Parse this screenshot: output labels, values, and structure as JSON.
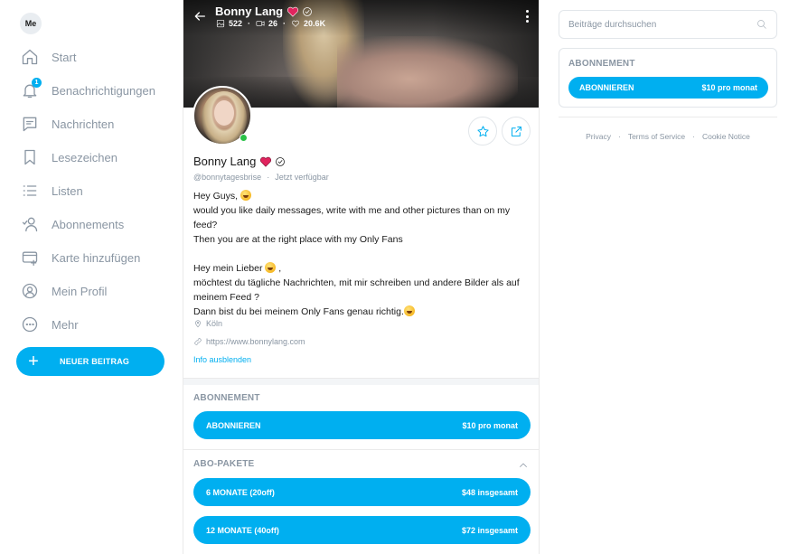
{
  "sidebar": {
    "avatar_initials": "Me",
    "notification_count": "1",
    "items": [
      {
        "label": "Start",
        "icon": "home-icon"
      },
      {
        "label": "Benachrichtigungen",
        "icon": "bell-icon"
      },
      {
        "label": "Nachrichten",
        "icon": "message-icon"
      },
      {
        "label": "Lesezeichen",
        "icon": "bookmark-icon"
      },
      {
        "label": "Listen",
        "icon": "list-icon"
      },
      {
        "label": "Abonnements",
        "icon": "subscriptions-icon"
      },
      {
        "label": "Karte hinzufügen",
        "icon": "card-icon"
      },
      {
        "label": "Mein Profil",
        "icon": "profile-icon"
      },
      {
        "label": "Mehr",
        "icon": "more-icon"
      }
    ],
    "new_post_label": "NEUER BEITRAG"
  },
  "cover": {
    "name": "Bonny Lang",
    "photos": "522",
    "videos": "26",
    "likes": "20.6K"
  },
  "profile": {
    "name": "Bonny Lang",
    "handle": "@bonnytagesbrise",
    "status": "Jetzt verfügbar",
    "bio_en_1": "Hey Guys, ",
    "bio_en_2": "would you like daily messages, write with me and other pictures than on my feed?",
    "bio_en_3": "Then you are at the right place with my Only Fans",
    "bio_de_1": "Hey mein Lieber ",
    "bio_de_1b": " ,",
    "bio_de_2": "möchtest du tägliche Nachrichten, mit mir schreiben und andere Bilder als auf meinem Feed ?",
    "bio_de_3": "Dann bist du bei meinem Only Fans genau richtig.",
    "location": "Köln",
    "website": "https://www.bonnylang.com",
    "info_toggle": "Info ausblenden"
  },
  "subscription": {
    "title": "ABONNEMENT",
    "button_label": "ABONNIEREN",
    "price": "$10 pro monat"
  },
  "bundles": {
    "title": "ABO-PAKETE",
    "items": [
      {
        "label": "6 MONATE (20off)",
        "price": "$48 insgesamt"
      },
      {
        "label": "12 MONATE (40off)",
        "price": "$72 insgesamt"
      }
    ]
  },
  "right": {
    "search_placeholder": "Beiträge durchsuchen",
    "sub_title": "ABONNEMENT",
    "sub_button": "ABONNIEREN",
    "sub_price": "$10 pro monat",
    "footer": [
      "Privacy",
      "Terms of Service",
      "Cookie Notice"
    ]
  },
  "colors": {
    "accent": "#00aff0",
    "muted": "#8a96a3",
    "online": "#29c146",
    "heart": "#e0245e"
  }
}
